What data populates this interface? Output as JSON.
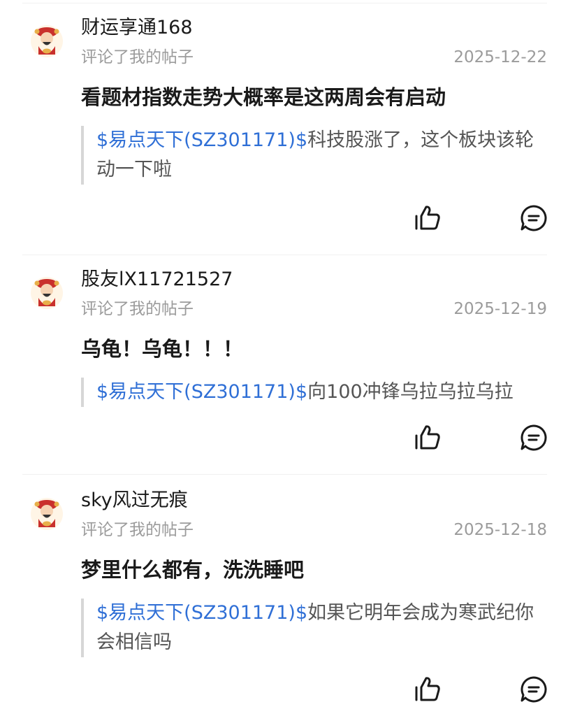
{
  "notifications": [
    {
      "username": "财运享通168",
      "action": "评论了我的帖子",
      "date": "2025-12-22",
      "comment": "看题材指数走势大概率是这两周会有启动",
      "quote_stock": "$易点天下(SZ301171)$",
      "quote_text": "科技股涨了，这个板块该轮动一下啦"
    },
    {
      "username": "股友lX11721527",
      "action": "评论了我的帖子",
      "date": "2025-12-19",
      "comment": "乌龟！乌龟！！！",
      "quote_stock": "$易点天下(SZ301171)$",
      "quote_text": "向100冲锋乌拉乌拉乌拉"
    },
    {
      "username": "sky风过无痕",
      "action": "评论了我的帖子",
      "date": "2025-12-18",
      "comment": "梦里什么都有，洗洗睡吧",
      "quote_stock": "$易点天下(SZ301171)$",
      "quote_text": "如果它明年会成为寒武纪你会相信吗"
    }
  ],
  "icons": {
    "like": "thumbs-up-icon",
    "reply": "comment-bubble-icon"
  },
  "colors": {
    "link": "#2f6fd6",
    "muted": "#9b9b9b",
    "quote_bar": "#d6d6d6"
  }
}
